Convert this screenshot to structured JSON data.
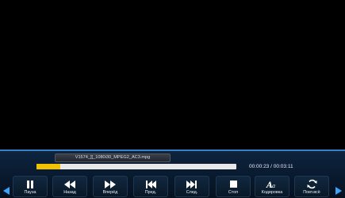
{
  "player": {
    "filename": "V1574_][_1080i30_MPEG2_AC3.mpg",
    "elapsed": "00:00:23",
    "total": "00:03:11",
    "time_separator": "/",
    "progress": 0.12
  },
  "controls": [
    {
      "label": "Пауза",
      "icon": "pause-icon",
      "active": true
    },
    {
      "label": "Назад",
      "icon": "rewind-icon",
      "active": false
    },
    {
      "label": "Вперёд",
      "icon": "fast-forward-icon",
      "active": false
    },
    {
      "label": "Пред.",
      "icon": "skip-previous-icon",
      "active": false
    },
    {
      "label": "След.",
      "icon": "skip-next-icon",
      "active": false
    },
    {
      "label": "Стоп",
      "icon": "stop-icon",
      "active": false
    },
    {
      "label": "Кодировка",
      "icon": "encoding-icon",
      "active": false
    },
    {
      "label": "Повт.всё",
      "icon": "repeat-icon",
      "active": false
    }
  ],
  "colors": {
    "accent": "#3aa3ff",
    "progress": "#f2c200",
    "panel": "#0a1d33"
  }
}
